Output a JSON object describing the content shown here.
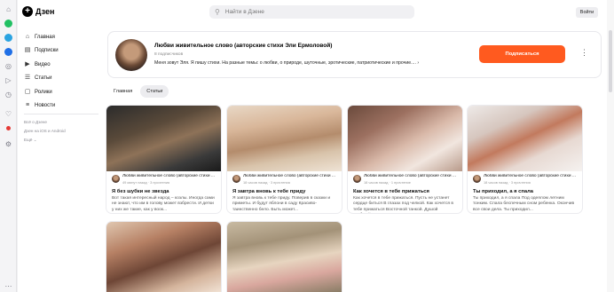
{
  "app": {
    "logo_text": "Дзен"
  },
  "search": {
    "placeholder": "Найти в Дзене"
  },
  "header": {
    "login_label": "Войти"
  },
  "nav": {
    "items": [
      {
        "label": "Главная",
        "icon": "home-icon"
      },
      {
        "label": "Подписки",
        "icon": "subscriptions-icon"
      },
      {
        "label": "Видео",
        "icon": "video-icon"
      },
      {
        "label": "Статьи",
        "icon": "articles-icon"
      },
      {
        "label": "Ролики",
        "icon": "shorts-icon"
      },
      {
        "label": "Новости",
        "icon": "news-icon"
      }
    ],
    "footer": {
      "line1": "Всё о Дзене",
      "line2": "Дзен на iOS и Android",
      "line3": "Ещё"
    }
  },
  "channel": {
    "name": "Любви живительное слово (авторские стихи Эли Ермоловой)",
    "subscribers": "8 подписчиков",
    "description": "Меня зовут Эля. Я пишу стихи. На разные темы: о любви, о природе, шуточные, эротические, патриотические и прочие....",
    "subscribe_label": "Подписаться"
  },
  "tabs": [
    {
      "label": "Главная",
      "active": false
    },
    {
      "label": "Статьи",
      "active": true
    }
  ],
  "cards": [
    {
      "channel": "Любви живительное слово (авторские стихи ...",
      "stats": "49 минут назад · 3 прочтения",
      "title": "Я без шубки не звезда",
      "snippet": "Вот такая интересный народ – козлы. Иногда сами не знают, что им в голову может взбрести. И детки у них же такие, как у воок..."
    },
    {
      "channel": "Любви живительное слово (авторские стихи ...",
      "stats": "18 часов назад · 3 прочтения",
      "title": "Я завтра вновь к тебе приду",
      "snippet": "Я завтра вновь к тебе приду. Поверив в сказки и приметы. И будут яблони в саду Красиво-таинственно бело. Быть может..."
    },
    {
      "channel": "Любви живительное слово (авторские стихи ...",
      "stats": "18 часов назад · 1 прочтение",
      "title": "Как хочется в тебе прижаться",
      "snippet": "Как хочется в тебе прижаться. Пусть не устанет сердце биться В глазах под челкой. Как хочется в тебе прижаться Восточной танкой. Душой озябшей..."
    },
    {
      "channel": "Любви живительное слово (авторские стихи ...",
      "stats": "18 часов назад · 3 прочтения",
      "title": "Ты приходил, а я спала",
      "snippet": "Ты приходил, а я спала Под одеялом летним тонким. Спала беспечным сном ребенка. Окончив все свои дела. Ты приходил..."
    },
    {
      "channel": "",
      "stats": "",
      "title": "",
      "snippet": ""
    },
    {
      "channel": "",
      "stats": "",
      "title": "",
      "snippet": ""
    }
  ],
  "colors": {
    "accent": "#ff5a1f",
    "background": "#ffffff"
  }
}
